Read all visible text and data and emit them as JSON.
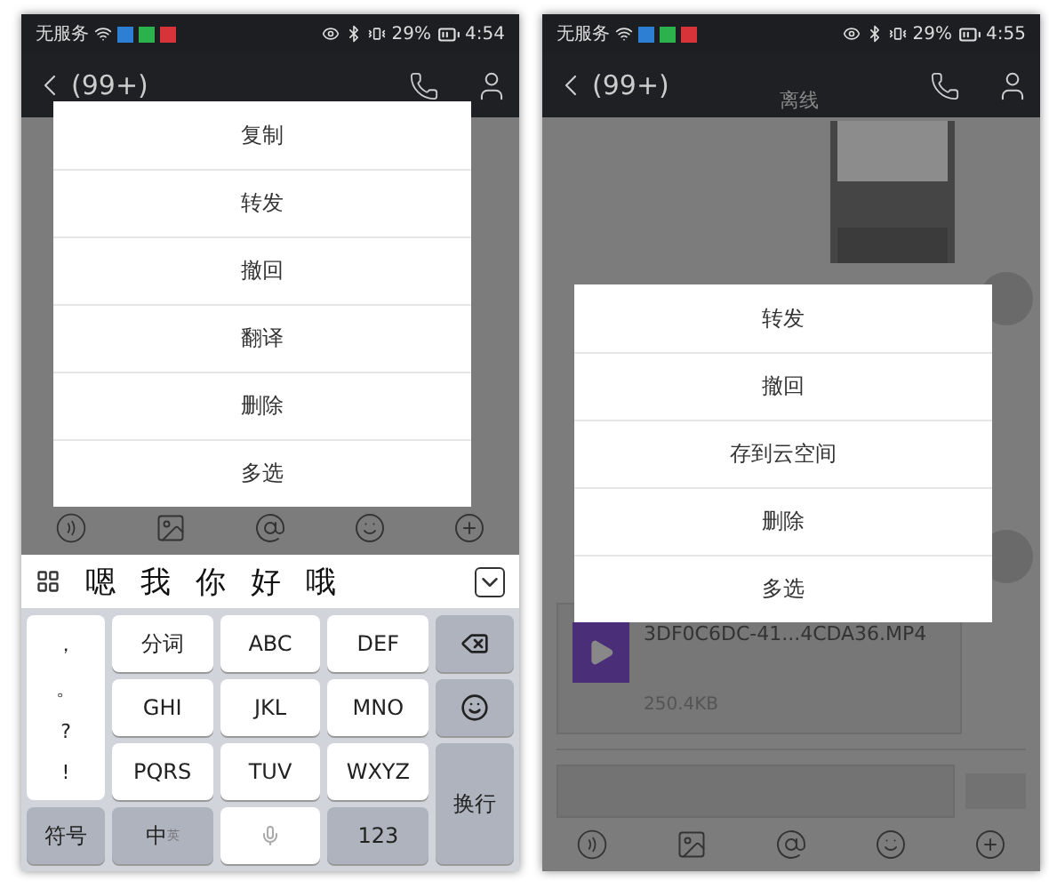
{
  "phones": [
    {
      "status_bar": {
        "carrier": "无服务",
        "battery": "29%",
        "time": "4:54"
      },
      "header": {
        "back": "(99+)"
      },
      "menu": [
        "复制",
        "转发",
        "撤回",
        "翻译",
        "删除",
        "多选"
      ],
      "keyboard": {
        "candidates": [
          "嗯",
          "我",
          "你",
          "好",
          "哦"
        ],
        "punctuation": [
          "，",
          "。",
          "?",
          "!"
        ],
        "keys": [
          "分词",
          "ABC",
          "DEF",
          "GHI",
          "JKL",
          "MNO",
          "PQRS",
          "TUV",
          "WXYZ"
        ],
        "enter": "换行",
        "symbols": "符号",
        "lang": "中",
        "lang_alt": "英",
        "numbers": "123"
      }
    },
    {
      "status_bar": {
        "carrier": "无服务",
        "battery": "29%",
        "time": "4:55"
      },
      "header": {
        "back": "(99+)",
        "subtitle": "离线"
      },
      "menu": [
        "转发",
        "撤回",
        "存到云空间",
        "删除",
        "多选"
      ],
      "file": {
        "name": "3DF0C6DC-41...4CDA36.MP4",
        "size": "250.4KB"
      }
    }
  ]
}
